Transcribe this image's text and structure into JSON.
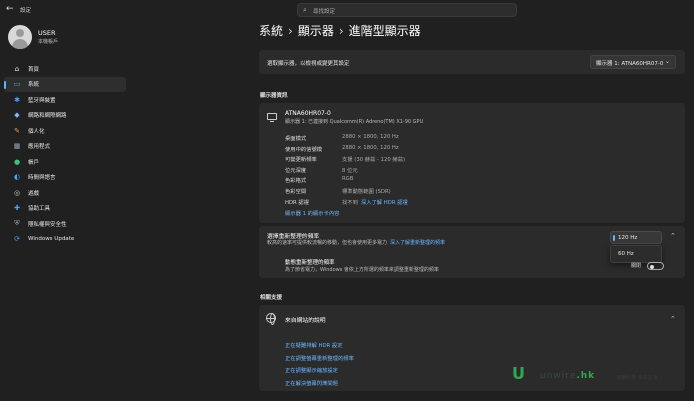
{
  "window": {
    "title": "設定",
    "back_glyph": "←"
  },
  "search": {
    "icon": "search-icon",
    "placeholder": "尋找設定"
  },
  "user": {
    "name": "USER",
    "account": "本機帳戶"
  },
  "sidebar": {
    "items": [
      {
        "label": "首頁",
        "icon": "home-icon",
        "glyph": "⌂",
        "color": "#e8e8e8"
      },
      {
        "label": "系統",
        "icon": "system-icon",
        "glyph": "▭",
        "color": "#4aa3ff",
        "selected": true
      },
      {
        "label": "藍牙與裝置",
        "icon": "bluetooth-icon",
        "glyph": "✱",
        "color": "#4aa3ff"
      },
      {
        "label": "網路和網際網路",
        "icon": "network-icon",
        "glyph": "◆",
        "color": "#7ab8ff"
      },
      {
        "label": "個人化",
        "icon": "brush-icon",
        "glyph": "✎",
        "color": "#e2a24a"
      },
      {
        "label": "應用程式",
        "icon": "apps-icon",
        "glyph": "▦",
        "color": "#9aa7b8"
      },
      {
        "label": "帳戶",
        "icon": "account-icon",
        "glyph": "●",
        "color": "#3fbf7f"
      },
      {
        "label": "時間與語言",
        "icon": "globe-clock-icon",
        "glyph": "◐",
        "color": "#4aa3ff"
      },
      {
        "label": "遊戲",
        "icon": "gamepad-icon",
        "glyph": "◎",
        "color": "#c8c8c8"
      },
      {
        "label": "協助工具",
        "icon": "accessibility-icon",
        "glyph": "✚",
        "color": "#4aa3ff"
      },
      {
        "label": "隱私權與安全性",
        "icon": "shield-icon",
        "glyph": "⛨",
        "color": "#9aa7b8"
      },
      {
        "label": "Windows Update",
        "icon": "update-icon",
        "glyph": "⟳",
        "color": "#4aa3ff"
      }
    ]
  },
  "breadcrumb": {
    "parts": [
      "系統",
      "顯示器",
      "進階型顯示器"
    ],
    "separator": "›"
  },
  "select_display": {
    "label": "選取顯示器，以檢視或變更其設定",
    "value": "顯示器 1: ATNA60HR07-0"
  },
  "display_info": {
    "section_title": "顯示器資訊",
    "monitor_name": "ATNA60HR07-0",
    "monitor_sub": "顯示器 1: 已連接到 Qualcomm(R) Adreno(TM) X1-90 GPU",
    "specs": [
      {
        "key": "桌面模式",
        "value": "2880 × 1800, 120 Hz"
      },
      {
        "key": "使用中的信號模",
        "value": "2880 × 1800, 120 Hz"
      },
      {
        "key": "可變更新頻率",
        "value": "支援 (30 赫茲 - 120 赫茲)"
      },
      {
        "key": "位元深度",
        "value": "8 位元"
      },
      {
        "key": "色彩格式",
        "value": "RGB"
      },
      {
        "key": "色彩空間",
        "value": "標準動態範圍 (SDR)"
      },
      {
        "key": "HDR 認證",
        "value": "找不到",
        "link": "深入了解 HDR 認證"
      }
    ],
    "adapter_link": "顯示器 1 的顯示卡內容"
  },
  "refresh_rate": {
    "title": "選擇重新整理的頻率",
    "desc": "較高的速率可提供較流暢的移動，但也會使用更多電力",
    "link": "深入了解重新整理的頻率",
    "selected": "120 Hz",
    "option": "60 Hz",
    "dynamic": {
      "title": "動態重新整理的頻率",
      "desc": "為了節省電力，Windows 會依上方所選的頻率來調整重新整理的頻率",
      "state": "關閉"
    }
  },
  "related": {
    "section_title": "相關支援",
    "card_title": "來自網站的說明",
    "links": [
      "正在疑難排解 HDR 設定",
      "正在調整螢幕重新整理的頻率",
      "正在調整顯示縮放設定",
      "正在解決螢幕閃爍問題"
    ]
  },
  "watermark": {
    "brand": "unwire",
    "tld": ".hk",
    "sub": "玩轉科技 未來生活"
  }
}
